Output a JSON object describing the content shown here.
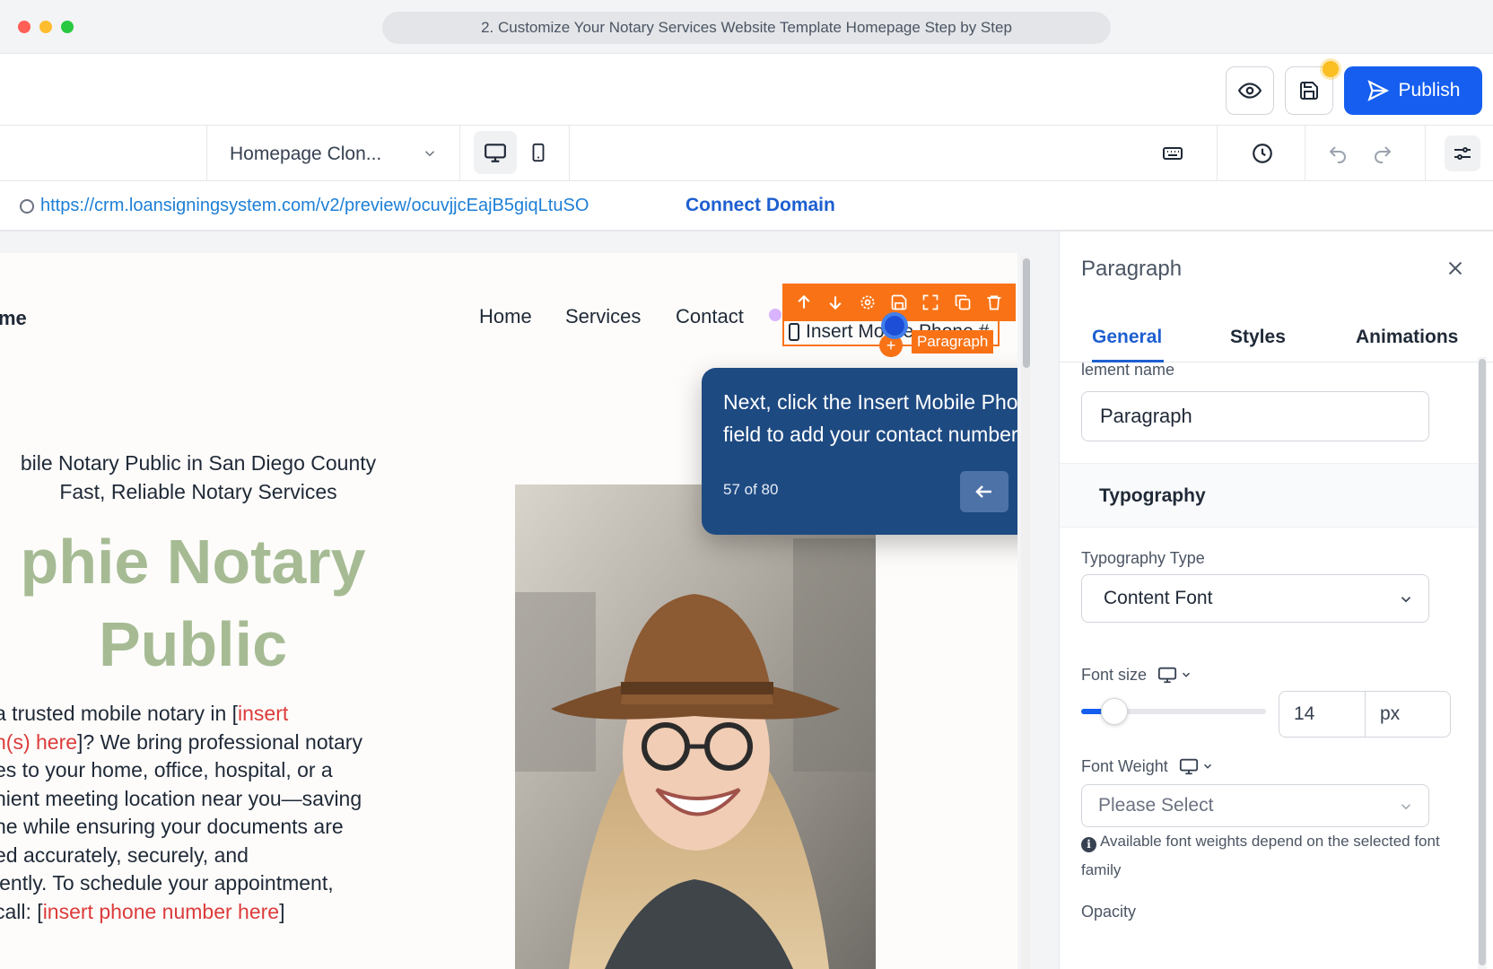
{
  "window": {
    "title": "2. Customize Your Notary Services Website Template Homepage Step by Step"
  },
  "actions": {
    "publish_label": "Publish",
    "preview_icon": "eye-icon",
    "save_icon": "floppy-disk-icon"
  },
  "toolbar": {
    "page_name": "Homepage Clon...",
    "devices": [
      "desktop",
      "mobile"
    ]
  },
  "urlbar": {
    "url": "https://crm.loansigningsystem.com/v2/preview/ocuvjjcEajB5giqLtuSO",
    "connect_label": "Connect Domain"
  },
  "site": {
    "brand_fragment": "me",
    "nav": [
      "Home",
      "Services",
      "Contact"
    ],
    "selected_element_text": "Insert Mobile Phone #",
    "selected_element_tag": "Paragraph",
    "hero_subtitle_1": "bile Notary Public in San Diego County",
    "hero_subtitle_2": "Fast, Reliable Notary Services",
    "hero_title_1": "phie Notary",
    "hero_title_2": "Public",
    "body": [
      {
        "text": "a trusted mobile notary in [",
        "hl": "insert"
      },
      {
        "hl": "n(s) here",
        "text": "]? We bring professional notary"
      },
      {
        "text": "es to your home, office, hospital, or a"
      },
      {
        "text": "nient meeting location near you—saving"
      },
      {
        "text": "ne while ensuring your documents are"
      },
      {
        "text": "ed accurately, securely, and"
      },
      {
        "text": "iently. To schedule your appointment,"
      },
      {
        "text": " call: [",
        "hl": "insert phone number here",
        "tail": "]"
      }
    ]
  },
  "tour": {
    "text": "Next, click the Insert Mobile Phone field to add your contact number.",
    "count": "57 of 80"
  },
  "panel": {
    "title": "Paragraph",
    "tabs": [
      "General",
      "Styles",
      "Animations"
    ],
    "active_tab": "General",
    "element_name_label": "lement name",
    "element_name_value": "Paragraph",
    "section": "Typography",
    "typography_type_label": "Typography Type",
    "typography_type_value": "Content Font",
    "font_size_label": "Font size",
    "font_size_value": "14",
    "font_size_unit": "px",
    "font_weight_label": "Font Weight",
    "font_weight_placeholder": "Please Select",
    "font_weight_hint": "Available font weights depend on the selected font family",
    "next_label": "Opacity"
  },
  "colors": {
    "accent": "#155eef",
    "selection": "#f97316",
    "hero_title": "#a6bb94",
    "highlight": "#dc3b3b",
    "tour_bg": "#1e4a82"
  }
}
